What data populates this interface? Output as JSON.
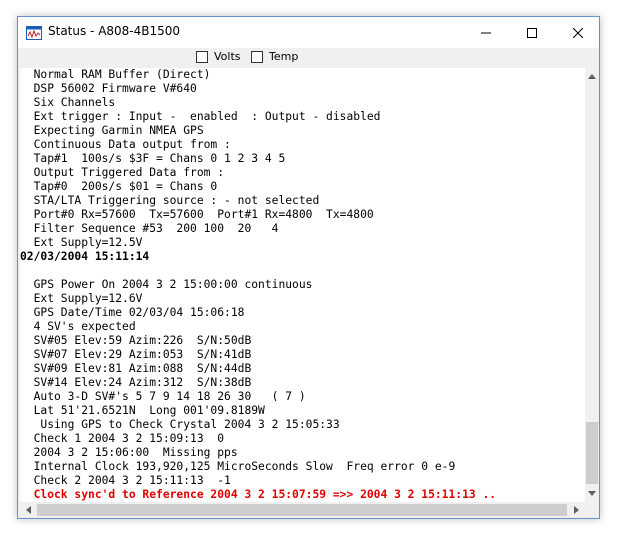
{
  "window": {
    "title": "Status - A808-4B1500"
  },
  "toolbar": {
    "volts_label": "Volts",
    "temp_label": "Temp",
    "volts_checked": false,
    "temp_checked": false
  },
  "icons": {
    "app": "status-app-icon",
    "minimize": "minimize-icon",
    "maximize": "maximize-icon",
    "close": "close-icon"
  },
  "colors": {
    "highlight": "#e00000",
    "border": "#6a8fcf"
  },
  "log": [
    {
      "text": "  Normal RAM Buffer (Direct)",
      "style": ""
    },
    {
      "text": "  DSP 56002 Firmware V#640",
      "style": ""
    },
    {
      "text": "  Six Channels",
      "style": ""
    },
    {
      "text": "  Ext trigger : Input -  enabled  : Output - disabled",
      "style": ""
    },
    {
      "text": "  Expecting Garmin NMEA GPS",
      "style": ""
    },
    {
      "text": "  Continuous Data output from :",
      "style": ""
    },
    {
      "text": "  Tap#1  100s/s $3F = Chans 0 1 2 3 4 5",
      "style": ""
    },
    {
      "text": "  Output Triggered Data from :",
      "style": ""
    },
    {
      "text": "  Tap#0  200s/s $01 = Chans 0",
      "style": ""
    },
    {
      "text": "  STA/LTA Triggering source : - not selected",
      "style": ""
    },
    {
      "text": "  Port#0 Rx=57600  Tx=57600  Port#1 Rx=4800  Tx=4800",
      "style": ""
    },
    {
      "text": "  Filter Sequence #53  200 100  20   4",
      "style": ""
    },
    {
      "text": "  Ext Supply=12.5V",
      "style": ""
    },
    {
      "text": "02/03/2004 15:11:14",
      "style": "bold"
    },
    {
      "text": "",
      "style": ""
    },
    {
      "text": "  GPS Power On 2004 3 2 15:00:00 continuous",
      "style": ""
    },
    {
      "text": "  Ext Supply=12.6V",
      "style": ""
    },
    {
      "text": "  GPS Date/Time 02/03/04 15:06:18",
      "style": ""
    },
    {
      "text": "  4 SV's expected",
      "style": ""
    },
    {
      "text": "  SV#05 Elev:59 Azim:226  S/N:50dB",
      "style": ""
    },
    {
      "text": "  SV#07 Elev:29 Azim:053  S/N:41dB",
      "style": ""
    },
    {
      "text": "  SV#09 Elev:81 Azim:088  S/N:44dB",
      "style": ""
    },
    {
      "text": "  SV#14 Elev:24 Azim:312  S/N:38dB",
      "style": ""
    },
    {
      "text": "  Auto 3-D SV#'s 5 7 9 14 18 26 30   ( 7 )",
      "style": ""
    },
    {
      "text": "  Lat 51'21.6521N  Long 001'09.8189W",
      "style": ""
    },
    {
      "text": "   Using GPS to Check Crystal 2004 3 2 15:05:33",
      "style": ""
    },
    {
      "text": "  Check 1 2004 3 2 15:09:13  0",
      "style": ""
    },
    {
      "text": "  2004 3 2 15:06:00  Missing pps",
      "style": ""
    },
    {
      "text": "  Internal Clock 193,920,125 MicroSeconds Slow  Freq error 0 e-9",
      "style": ""
    },
    {
      "text": "  Check 2 2004 3 2 15:11:13  -1",
      "style": ""
    },
    {
      "text": "  Clock sync'd to Reference 2004 3 2 15:07:59 =>> 2004 3 2 15:11:13 ..",
      "style": "red"
    }
  ]
}
